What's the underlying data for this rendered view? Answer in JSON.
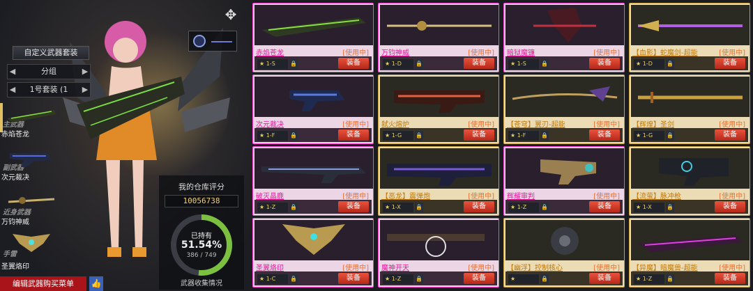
{
  "left_panel": {
    "title": "自定义武器套装",
    "filter": "分组",
    "set": "1号套装 (1",
    "slots": [
      {
        "label": "主武器",
        "name": "赤焰苍龙"
      },
      {
        "label": "副武器",
        "name": "次元裁决"
      },
      {
        "label": "近身武器",
        "name": "万钧神威"
      },
      {
        "label": "手雷",
        "name": "圣翼烙印"
      }
    ],
    "score_title": "我的仓库评分",
    "score_value": "10056738",
    "owned_label": "已持有",
    "owned_percent": "51.54%",
    "owned_count": "386 / 749",
    "owned_fraction": 0.5154,
    "collection_label": "武器收集情况",
    "edit_button": "编辑武器购买菜单"
  },
  "cards": [
    {
      "name": "赤焰苍龙",
      "status": "[使用中]",
      "rank": "★ 1-S",
      "equip": "装备",
      "style": "pink"
    },
    {
      "name": "万钧神威",
      "status": "[使用中]",
      "rank": "★ 1-D",
      "equip": "装备",
      "style": "pink"
    },
    {
      "name": "暗狱魔镰",
      "status": "[使用中]",
      "rank": "★ 1-S",
      "equip": "装备",
      "style": "pink"
    },
    {
      "name": "【血影】蛇魔剑-超能",
      "status": "[使用中]",
      "rank": "★ 1-D",
      "equip": "装备",
      "style": "gold"
    },
    {
      "name": "次元裁决",
      "status": "[使用中]",
      "rank": "★ 1-F",
      "equip": "装备",
      "style": "pink"
    },
    {
      "name": "弑火熔炉",
      "status": "[使用中]",
      "rank": "★ 1-G",
      "equip": "装备",
      "style": "gold"
    },
    {
      "name": "【苍穹】翼刃-超能",
      "status": "[使用中]",
      "rank": "★ 1-F",
      "equip": "装备",
      "style": "gold"
    },
    {
      "name": "【辉煌】圣剑",
      "status": "[使用中]",
      "rank": "★ 1-G",
      "equip": "装备",
      "style": "gold"
    },
    {
      "name": "破灭晶鹿",
      "status": "[使用中]",
      "rank": "★ 1-Z",
      "equip": "装备",
      "style": "pink"
    },
    {
      "name": "【恶龙】震弹炮",
      "status": "[使用中]",
      "rank": "★ 1-X",
      "equip": "装备",
      "style": "gold"
    },
    {
      "name": "辉耀审判",
      "status": "[使用中]",
      "rank": "★ 1-Z",
      "equip": "装备",
      "style": "pink"
    },
    {
      "name": "【流萤】脉冲枪",
      "status": "[使用中]",
      "rank": "★ 1-X",
      "equip": "装备",
      "style": "gold"
    },
    {
      "name": "圣翼烙印",
      "status": "[使用中]",
      "rank": "★ 1-C",
      "equip": "装备",
      "style": "pink"
    },
    {
      "name": "魔神开天",
      "status": "[使用中]",
      "rank": "★ 1-Z",
      "equip": "装备",
      "style": "pink"
    },
    {
      "name": "【幽浮】控制核心",
      "status": "[使用中]",
      "rank": "★",
      "equip": "装备",
      "style": "gold"
    },
    {
      "name": "【异魔】暗魔兽-超能",
      "status": "[使用中]",
      "rank": "★ 1-Z",
      "equip": "装备",
      "style": "gold"
    }
  ],
  "colors": {
    "equip": "#d23a24",
    "pink_border": "#ff40d0",
    "gold_border": "#c8a040",
    "in_use": "#f07030"
  }
}
